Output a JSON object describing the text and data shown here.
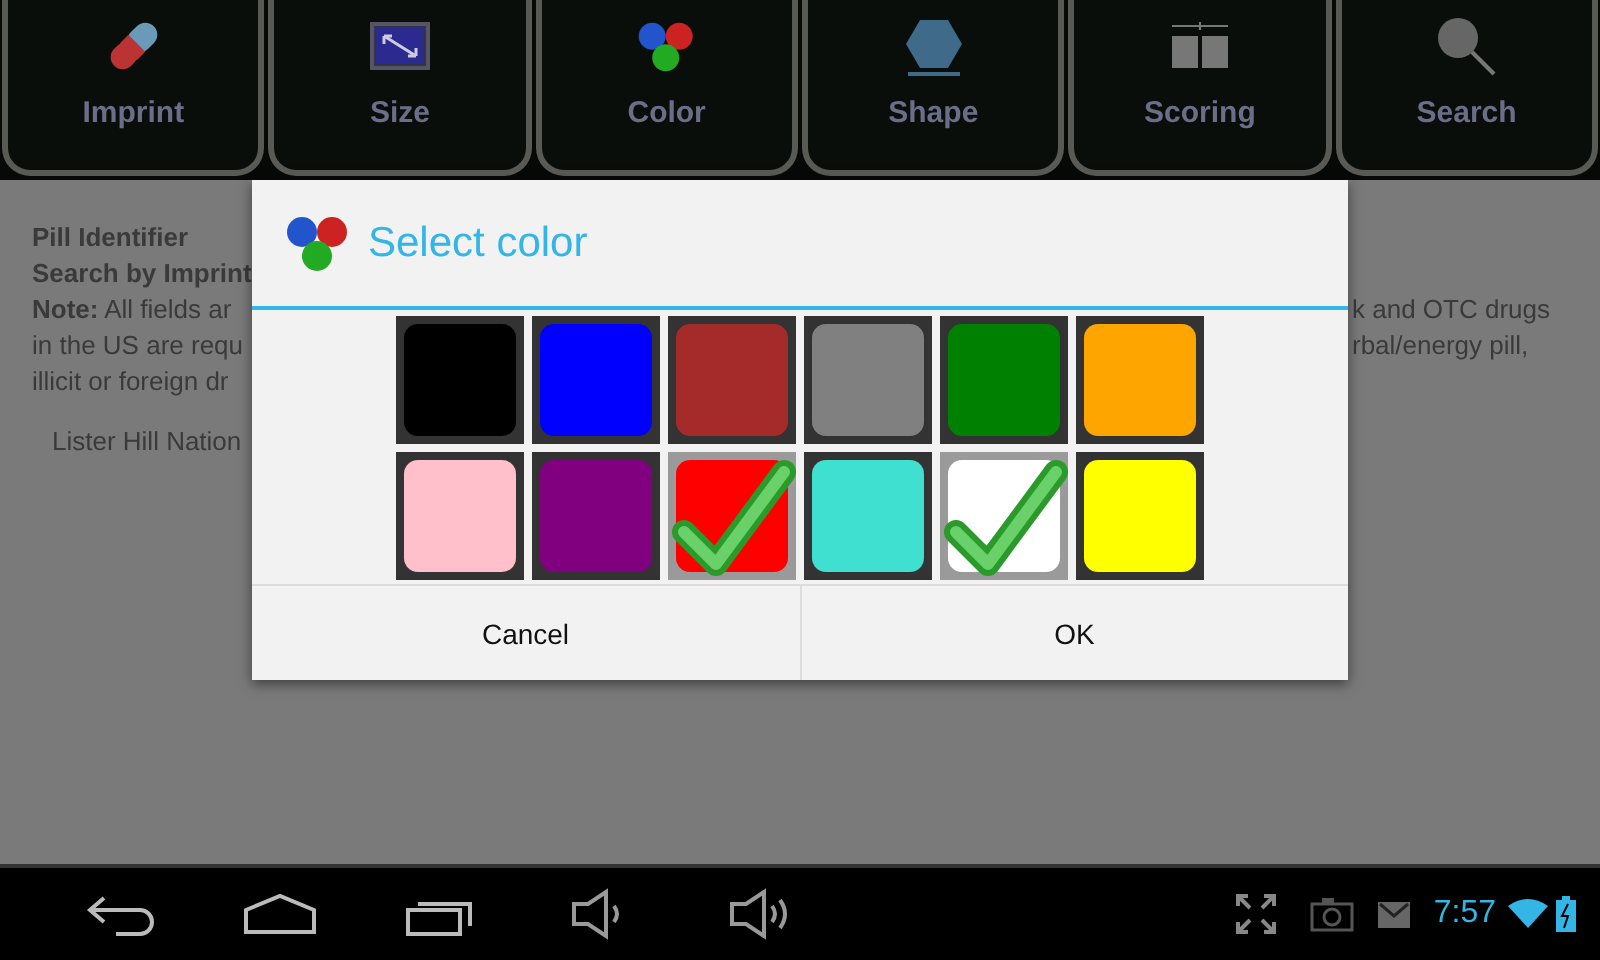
{
  "toolbar": {
    "tabs": [
      {
        "label": "Imprint",
        "kind": "pill"
      },
      {
        "label": "Size",
        "kind": "size"
      },
      {
        "label": "Color",
        "kind": "color"
      },
      {
        "label": "Shape",
        "kind": "shape"
      },
      {
        "label": "Scoring",
        "kind": "scoring"
      },
      {
        "label": "Search",
        "kind": "search"
      }
    ]
  },
  "background": {
    "left_lines": [
      {
        "text": "Pill Identifier",
        "kind": "heading"
      },
      {
        "text": "Search by Imprint",
        "kind": "heading"
      },
      {
        "text": " **Note:** All fields ar",
        "kind": "body"
      },
      {
        "text": "in the US are requ",
        "kind": "body"
      },
      {
        "text": "illicit or foreign dr",
        "kind": "body"
      },
      {
        "text": "Lister Hill Nation",
        "kind": "credit"
      }
    ],
    "right_lines": [
      "k and OTC drugs",
      "rbal/energy pill,"
    ]
  },
  "dialog": {
    "title": "Select color",
    "colors": [
      {
        "color": "#000000",
        "selected": false
      },
      {
        "color": "#0000ff",
        "selected": false
      },
      {
        "color": "#a52a2a",
        "selected": false
      },
      {
        "color": "#808080",
        "selected": false
      },
      {
        "color": "#008000",
        "selected": false
      },
      {
        "color": "#ffa500",
        "selected": false
      },
      {
        "color": "#ffc0cb",
        "selected": false
      },
      {
        "color": "#800080",
        "selected": false
      },
      {
        "color": "#ff0000",
        "selected": true
      },
      {
        "color": "#40e0d0",
        "selected": false
      },
      {
        "color": "#ffffff",
        "selected": true
      },
      {
        "color": "#ffff00",
        "selected": false
      }
    ],
    "buttons": [
      "Cancel",
      "OK"
    ]
  },
  "status_bar": {
    "time": "7:57"
  }
}
